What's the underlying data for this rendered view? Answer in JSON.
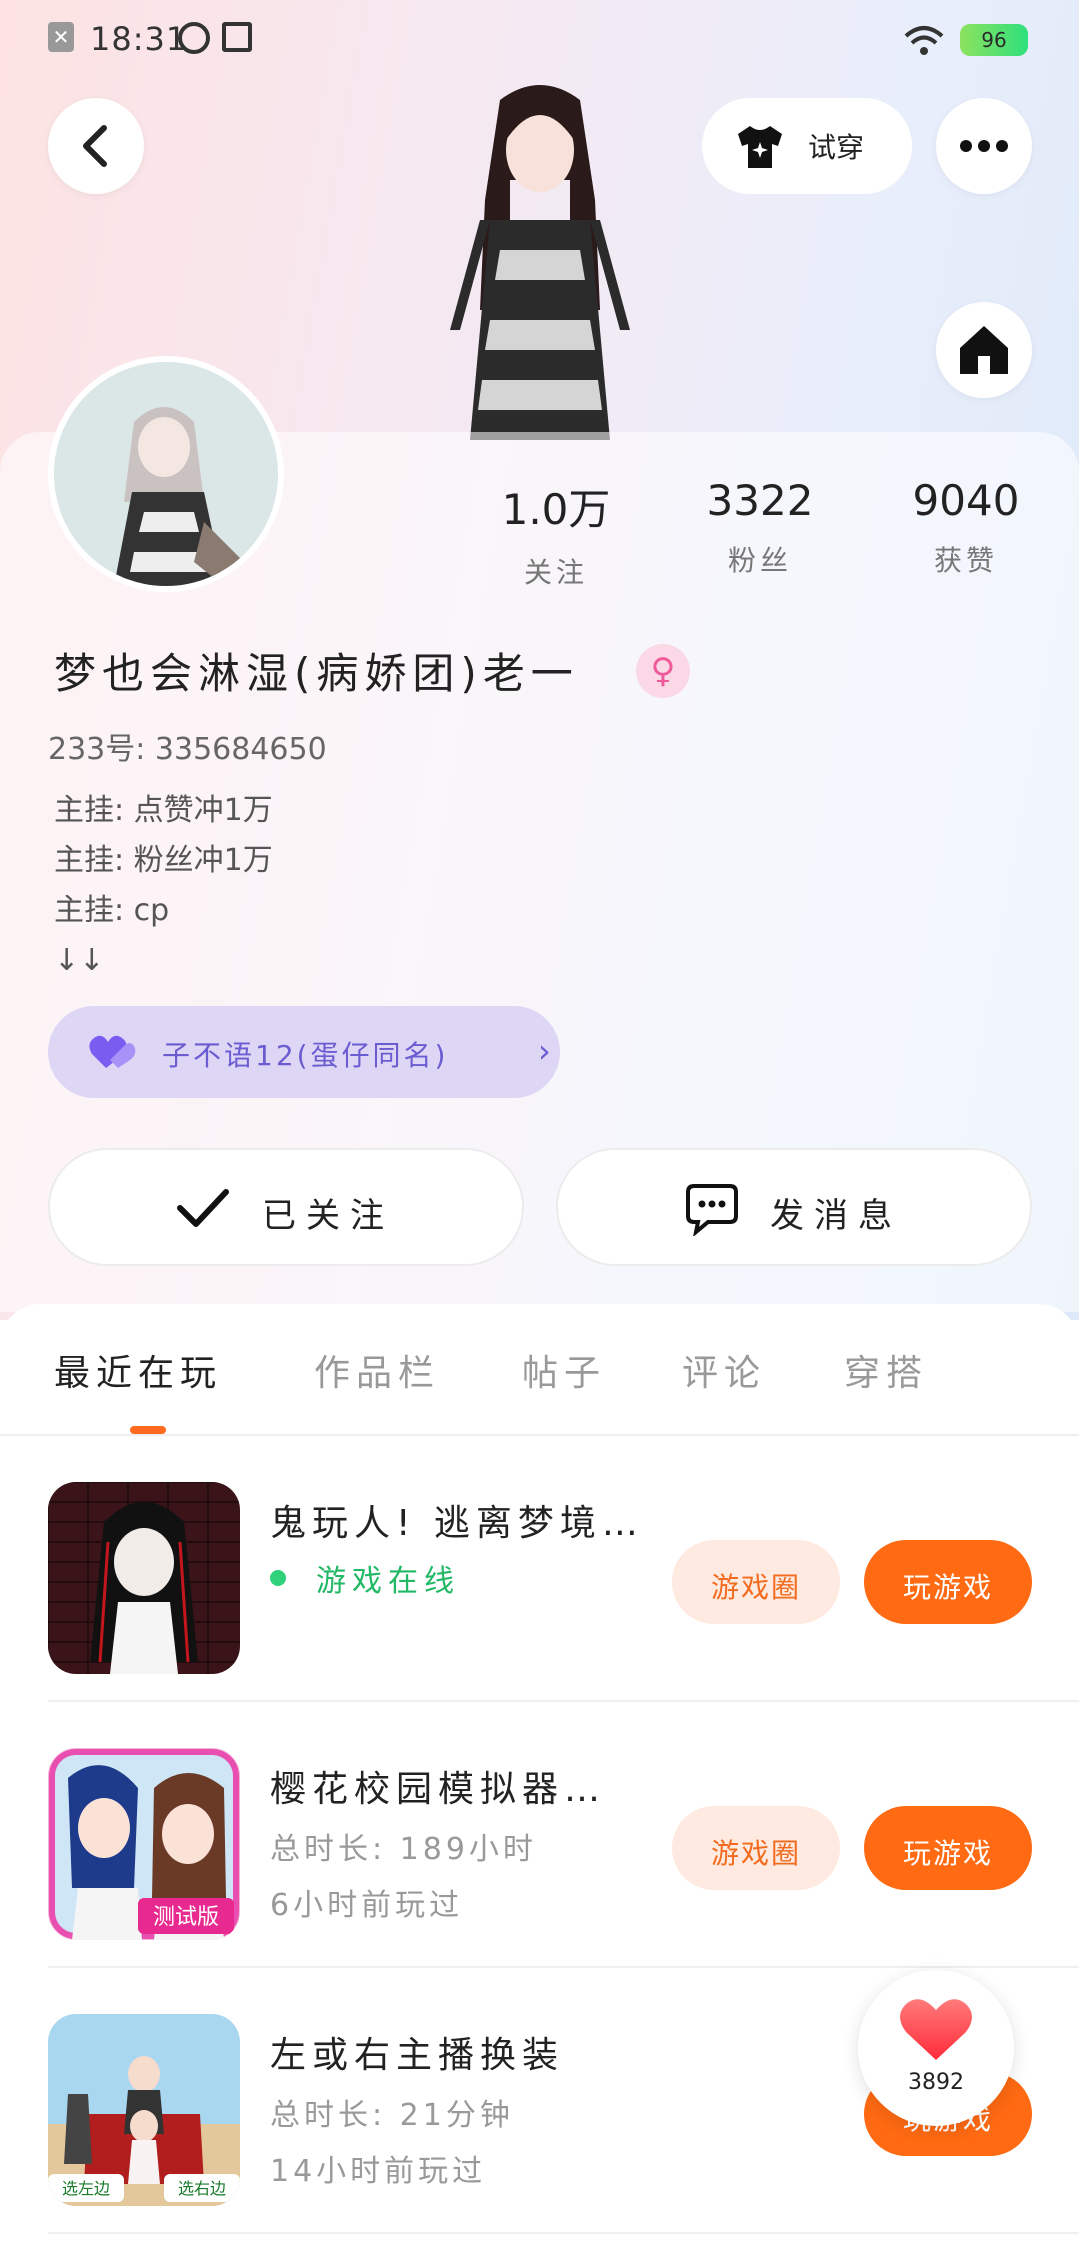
{
  "status_bar": {
    "time": "18:31",
    "battery": "96"
  },
  "header": {
    "tryon_label": "试穿"
  },
  "profile": {
    "stats": [
      {
        "value": "1.0万",
        "label": "关注"
      },
      {
        "value": "3322",
        "label": "粉丝"
      },
      {
        "value": "9040",
        "label": "获赞"
      }
    ],
    "name": "梦也会淋湿(病娇团)老一",
    "gender_symbol": "♀",
    "uid": "233号: 335684650",
    "bio": [
      "主挂: 点赞冲1万",
      "主挂: 粉丝冲1万",
      "主挂: cp",
      "↓↓"
    ],
    "group_label": "子不语12(蛋仔同名)",
    "follow_label": "已关注",
    "message_label": "发消息"
  },
  "tabs": [
    "最近在玩",
    "作品栏",
    "帖子",
    "评论",
    "穿搭"
  ],
  "active_tab": "最近在玩",
  "games": [
    {
      "title": "鬼玩人! 逃离梦境…",
      "status": "游戏在线",
      "circle_label": "游戏圈",
      "play_label": "玩游戏"
    },
    {
      "title": "樱花校园模拟器…",
      "duration": "总时长: 189小时",
      "last_played": "6小时前玩过",
      "circle_label": "游戏圈",
      "play_label": "玩游戏",
      "badge": "测试版"
    },
    {
      "title": "左或右主播换装",
      "duration": "总时长: 21分钟",
      "last_played": "14小时前玩过",
      "play_label": "玩游戏",
      "thumb_left": "选左边",
      "thumb_right": "选右边"
    }
  ],
  "like_fab": {
    "count": "3892"
  },
  "colors": {
    "accent": "#ff6a12",
    "online": "#22b865",
    "group": "#6a5cd1"
  }
}
